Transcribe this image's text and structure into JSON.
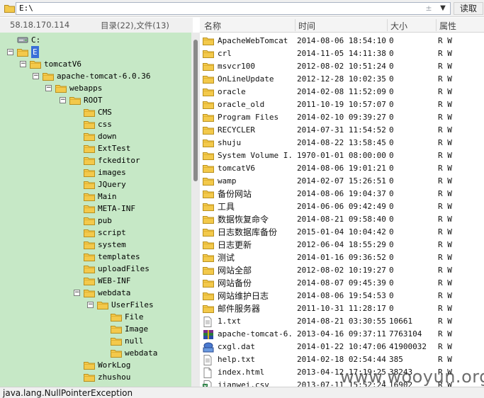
{
  "address": {
    "path": "E:\\",
    "read_label": "读取",
    "up_glyph": "±",
    "dropdown_glyph": "▼"
  },
  "info": {
    "ip": "58.18.170.114",
    "counts": "目录(22),文件(13)"
  },
  "tree": [
    {
      "label": "C:",
      "icon": "drive-icon",
      "depth": 0,
      "toggle": ""
    },
    {
      "label": "E",
      "icon": "folder-icon",
      "depth": 0,
      "toggle": "⊟",
      "selected": true
    },
    {
      "label": "tomcatV6",
      "icon": "folder-icon",
      "depth": 1,
      "toggle": "⊟"
    },
    {
      "label": "apache-tomcat-6.0.36",
      "icon": "folder-icon",
      "depth": 2,
      "toggle": "⊟"
    },
    {
      "label": "webapps",
      "icon": "folder-icon",
      "depth": 3,
      "toggle": "⊟"
    },
    {
      "label": "ROOT",
      "icon": "folder-icon",
      "depth": 4,
      "toggle": "⊟"
    },
    {
      "label": "CMS",
      "icon": "folder-icon",
      "depth": 5,
      "toggle": ""
    },
    {
      "label": "css",
      "icon": "folder-icon",
      "depth": 5,
      "toggle": ""
    },
    {
      "label": "down",
      "icon": "folder-icon",
      "depth": 5,
      "toggle": ""
    },
    {
      "label": "ExtTest",
      "icon": "folder-icon",
      "depth": 5,
      "toggle": ""
    },
    {
      "label": "fckeditor",
      "icon": "folder-icon",
      "depth": 5,
      "toggle": ""
    },
    {
      "label": "images",
      "icon": "folder-icon",
      "depth": 5,
      "toggle": ""
    },
    {
      "label": "JQuery",
      "icon": "folder-icon",
      "depth": 5,
      "toggle": ""
    },
    {
      "label": "Main",
      "icon": "folder-icon",
      "depth": 5,
      "toggle": ""
    },
    {
      "label": "META-INF",
      "icon": "folder-icon",
      "depth": 5,
      "toggle": ""
    },
    {
      "label": "pub",
      "icon": "folder-icon",
      "depth": 5,
      "toggle": ""
    },
    {
      "label": "script",
      "icon": "folder-icon",
      "depth": 5,
      "toggle": ""
    },
    {
      "label": "system",
      "icon": "folder-icon",
      "depth": 5,
      "toggle": ""
    },
    {
      "label": "templates",
      "icon": "folder-icon",
      "depth": 5,
      "toggle": ""
    },
    {
      "label": "uploadFiles",
      "icon": "folder-icon",
      "depth": 5,
      "toggle": ""
    },
    {
      "label": "WEB-INF",
      "icon": "folder-icon",
      "depth": 5,
      "toggle": ""
    },
    {
      "label": "webdata",
      "icon": "folder-icon",
      "depth": 4,
      "toggle": "⊟",
      "indent_override": 5
    },
    {
      "label": "UserFiles",
      "icon": "folder-icon",
      "depth": 6,
      "toggle": "⊟"
    },
    {
      "label": "File",
      "icon": "folder-icon",
      "depth": 7,
      "toggle": ""
    },
    {
      "label": "Image",
      "icon": "folder-icon",
      "depth": 7,
      "toggle": ""
    },
    {
      "label": "null",
      "icon": "folder-icon",
      "depth": 7,
      "toggle": ""
    },
    {
      "label": "webdata",
      "icon": "folder-icon",
      "depth": 7,
      "toggle": ""
    },
    {
      "label": "WorkLog",
      "icon": "folder-icon",
      "depth": 5,
      "toggle": ""
    },
    {
      "label": "zhushou",
      "icon": "folder-icon",
      "depth": 5,
      "toggle": ""
    }
  ],
  "list": {
    "headers": {
      "name": "名称",
      "time": "时间",
      "size": "大小",
      "attr": "属性"
    },
    "rows": [
      {
        "name": "ApacheWebTomcat",
        "time": "2014-08-06 18:54:10",
        "size": "0",
        "attr": "R W",
        "icon": "folder-icon"
      },
      {
        "name": "crl",
        "time": "2014-11-05 14:11:38",
        "size": "0",
        "attr": "R W",
        "icon": "folder-icon"
      },
      {
        "name": "msvcr100",
        "time": "2012-08-02 10:51:24",
        "size": "0",
        "attr": "R W",
        "icon": "folder-icon"
      },
      {
        "name": "OnLineUpdate",
        "time": "2012-12-28 10:02:35",
        "size": "0",
        "attr": "R W",
        "icon": "folder-icon"
      },
      {
        "name": "oracle",
        "time": "2014-02-08 11:52:09",
        "size": "0",
        "attr": "R W",
        "icon": "folder-icon"
      },
      {
        "name": "oracle_old",
        "time": "2011-10-19 10:57:07",
        "size": "0",
        "attr": "R W",
        "icon": "folder-icon"
      },
      {
        "name": "Program Files",
        "time": "2014-02-10 09:39:27",
        "size": "0",
        "attr": "R W",
        "icon": "folder-icon"
      },
      {
        "name": "RECYCLER",
        "time": "2014-07-31 11:54:52",
        "size": "0",
        "attr": "R W",
        "icon": "folder-icon"
      },
      {
        "name": "shuju",
        "time": "2014-08-22 13:58:45",
        "size": "0",
        "attr": "R W",
        "icon": "folder-icon"
      },
      {
        "name": "System Volume I...",
        "time": "1970-01-01 08:00:00",
        "size": "0",
        "attr": "R W",
        "icon": "folder-icon"
      },
      {
        "name": "tomcatV6",
        "time": "2014-08-06 19:01:21",
        "size": "0",
        "attr": "R W",
        "icon": "folder-icon"
      },
      {
        "name": "wamp",
        "time": "2014-02-07 15:26:51",
        "size": "0",
        "attr": "R W",
        "icon": "folder-icon"
      },
      {
        "name": "备份网站",
        "time": "2014-08-06 19:04:37",
        "size": "0",
        "attr": "R W",
        "icon": "folder-icon"
      },
      {
        "name": "工具",
        "time": "2014-06-06 09:42:49",
        "size": "0",
        "attr": "R W",
        "icon": "folder-icon"
      },
      {
        "name": "数据恢复命令",
        "time": "2014-08-21 09:58:40",
        "size": "0",
        "attr": "R W",
        "icon": "folder-icon"
      },
      {
        "name": "日志数据库备份",
        "time": "2015-01-04 10:04:42",
        "size": "0",
        "attr": "R W",
        "icon": "folder-icon"
      },
      {
        "name": "日志更新",
        "time": "2012-06-04 18:55:29",
        "size": "0",
        "attr": "R W",
        "icon": "folder-icon"
      },
      {
        "name": "测试",
        "time": "2014-01-16 09:36:52",
        "size": "0",
        "attr": "R W",
        "icon": "folder-icon"
      },
      {
        "name": "网站全部",
        "time": "2012-08-02 10:19:27",
        "size": "0",
        "attr": "R W",
        "icon": "folder-icon"
      },
      {
        "name": "网站备份",
        "time": "2014-08-07 09:45:39",
        "size": "0",
        "attr": "R W",
        "icon": "folder-icon"
      },
      {
        "name": "网站维护日志",
        "time": "2014-08-06 19:54:53",
        "size": "0",
        "attr": "R W",
        "icon": "folder-icon"
      },
      {
        "name": "邮件服务器",
        "time": "2011-10-31 11:28:17",
        "size": "0",
        "attr": "R W",
        "icon": "folder-icon"
      },
      {
        "name": "1.txt",
        "time": "2014-08-21 03:30:55",
        "size": "10661",
        "attr": "R W",
        "icon": "text-file-icon"
      },
      {
        "name": "apache-tomcat-6....",
        "time": "2013-04-16 09:37:11",
        "size": "7763104",
        "attr": "R W",
        "icon": "archive-icon"
      },
      {
        "name": "cxgl.dat",
        "time": "2014-01-22 10:47:06",
        "size": "41900032",
        "attr": "R W",
        "icon": "dat-file-icon"
      },
      {
        "name": "help.txt",
        "time": "2014-02-18 02:54:44",
        "size": "385",
        "attr": "R W",
        "icon": "text-file-icon"
      },
      {
        "name": "index.html",
        "time": "2013-04-12 17:19:25",
        "size": "38243",
        "attr": "R W",
        "icon": "html-file-icon"
      },
      {
        "name": "jianwei.csv",
        "time": "2013-07-11 15:52:24",
        "size": "16902",
        "attr": "R W",
        "icon": "csv-file-icon"
      }
    ]
  },
  "status": {
    "text": "java.lang.NullPointerException"
  },
  "watermark": "www.wooyun.org"
}
